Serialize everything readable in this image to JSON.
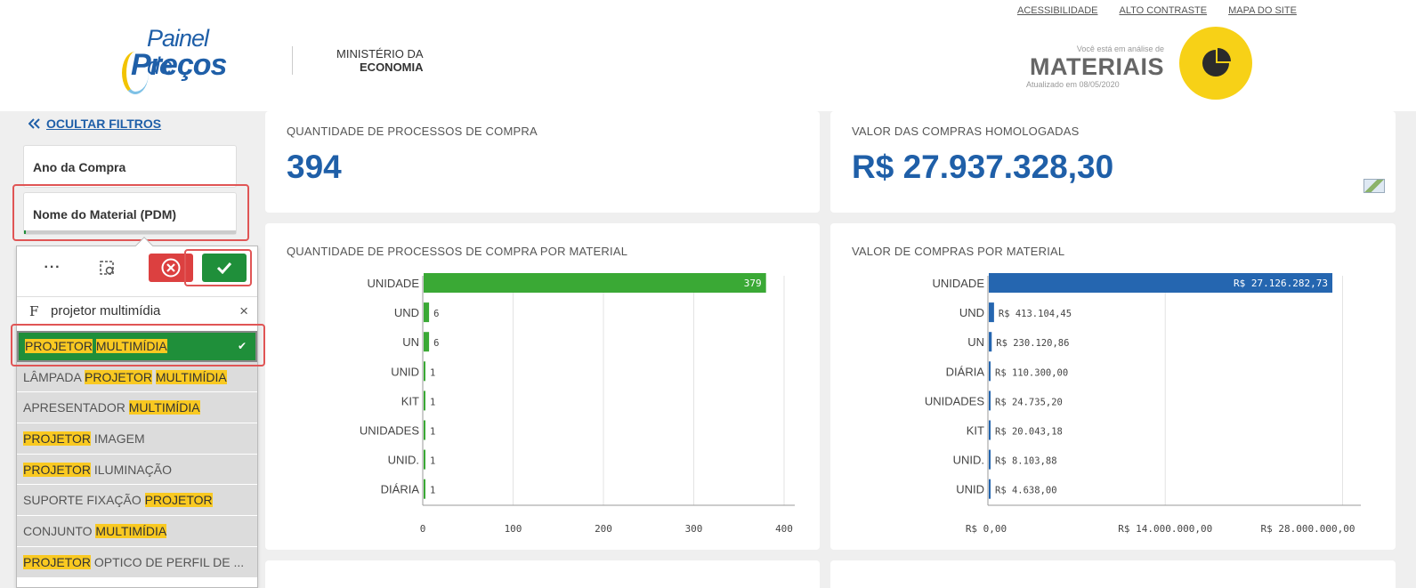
{
  "header": {
    "links": [
      "ACESSIBILIDADE",
      "ALTO CONTRASTE",
      "MAPA DO SITE"
    ],
    "logo_line1": "Painel de",
    "logo_line2": "Preços",
    "ministry_line1": "MINISTÉRIO DA",
    "ministry_line2": "ECONOMIA",
    "analysis_intro": "Você está em análise de",
    "analysis_type": "MATERIAIS",
    "updated": "Atualizado em 08/05/2020",
    "brand_yellow": "#f7d117",
    "brand_blue": "#1f5fa8"
  },
  "filters": {
    "hide_label": "OCULTAR FILTROS",
    "cards": [
      "Ano da Compra",
      "Nome do Material (PDM)"
    ],
    "search_prefix": "F",
    "search_value": "projetor multimídia",
    "items": [
      {
        "parts": [
          {
            "t": "PROJETOR",
            "h": true
          },
          {
            "t": " ",
            "h": false
          },
          {
            "t": "MULTIMÍDIA",
            "h": true
          }
        ],
        "selected": true
      },
      {
        "parts": [
          {
            "t": "LÂMPADA ",
            "h": false
          },
          {
            "t": "PROJETOR",
            "h": true
          },
          {
            "t": " ",
            "h": false
          },
          {
            "t": "MULTIMÍDIA",
            "h": true
          }
        ]
      },
      {
        "parts": [
          {
            "t": "APRESENTADOR ",
            "h": false
          },
          {
            "t": "MULTIMÍDIA",
            "h": true
          }
        ]
      },
      {
        "parts": [
          {
            "t": "PROJETOR",
            "h": true
          },
          {
            "t": " IMAGEM",
            "h": false
          }
        ]
      },
      {
        "parts": [
          {
            "t": "PROJETOR",
            "h": true
          },
          {
            "t": " ILUMINAÇÃO",
            "h": false
          }
        ]
      },
      {
        "parts": [
          {
            "t": "SUPORTE FIXAÇÃO ",
            "h": false
          },
          {
            "t": "PROJETOR",
            "h": true
          }
        ]
      },
      {
        "parts": [
          {
            "t": "CONJUNTO ",
            "h": false
          },
          {
            "t": "MULTIMÍDIA",
            "h": true
          }
        ]
      },
      {
        "parts": [
          {
            "t": "PROJETOR",
            "h": true
          },
          {
            "t": " OPTICO DE PERFIL DE ...",
            "h": false
          }
        ]
      }
    ]
  },
  "kpis": {
    "count_title": "QUANTIDADE DE PROCESSOS DE COMPRA",
    "count_value": "394",
    "value_title": "VALOR DAS COMPRAS HOMOLOGADAS",
    "value_value": "R$ 27.937.328,30"
  },
  "chart_data": [
    {
      "type": "bar",
      "orientation": "horizontal",
      "title": "QUANTIDADE DE PROCESSOS DE COMPRA POR MATERIAL",
      "categories": [
        "UNIDADE",
        "UND",
        "UN",
        "UNID",
        "KIT",
        "UNIDADES",
        "UNID.",
        "DIÁRIA"
      ],
      "values": [
        379,
        6,
        6,
        1,
        1,
        1,
        1,
        1
      ],
      "labels": [
        "379",
        "6",
        "6",
        "1",
        "1",
        "1",
        "1",
        "1"
      ],
      "xlim": [
        0,
        400
      ],
      "xticks": [
        0,
        100,
        200,
        300,
        400
      ],
      "xtick_labels": [
        "0",
        "100",
        "200",
        "300",
        "400"
      ],
      "color": "#3aa935",
      "grid": true
    },
    {
      "type": "bar",
      "orientation": "horizontal",
      "title": "VALOR DE COMPRAS POR MATERIAL",
      "categories": [
        "UNIDADE",
        "UND",
        "UN",
        "DIÁRIA",
        "UNIDADES",
        "KIT",
        "UNID.",
        "UNID"
      ],
      "values": [
        27126282.73,
        413104.45,
        230120.86,
        110300.0,
        24735.2,
        20043.18,
        8103.88,
        4638.0
      ],
      "labels": [
        "R$ 27.126.282,73",
        "R$ 413.104,45",
        "R$ 230.120,86",
        "R$ 110.300,00",
        "R$ 24.735,20",
        "R$ 20.043,18",
        "R$ 8.103,88",
        "R$ 4.638,00"
      ],
      "xlim": [
        0,
        28600000
      ],
      "xticks": [
        0,
        14000000,
        28000000
      ],
      "xtick_labels": [
        "R$ 0,00",
        "R$ 14.000.000,00",
        "R$ 28.000.000,00"
      ],
      "color": "#2566b0",
      "grid": true
    }
  ]
}
